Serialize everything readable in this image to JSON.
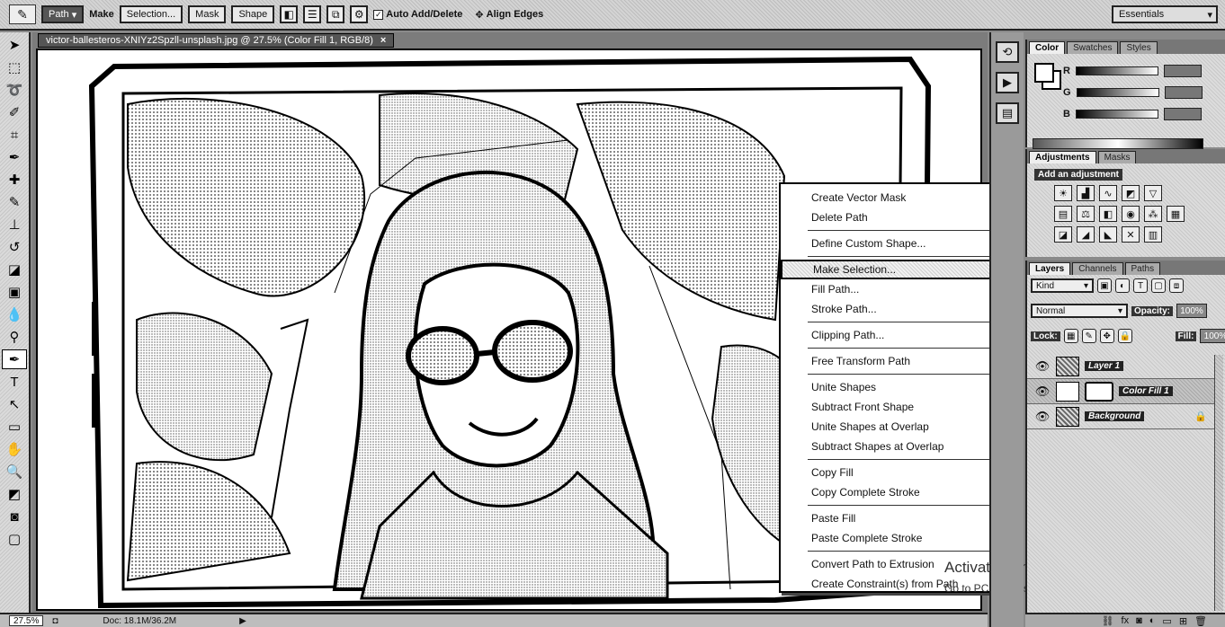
{
  "options_bar": {
    "mode_buttons": [
      "Path",
      "Make",
      "Selection...",
      "Mask",
      "Shape"
    ],
    "mode_label": "Make:",
    "auto_add_delete": "Auto Add/Delete",
    "align_edges": "Align Edges",
    "workspace": "Essentials"
  },
  "document": {
    "tab_title": "victor-ballesteros-XNIYz2Spzll-unsplash.jpg @ 27.5% (Color Fill 1, RGB/8)",
    "tab_close": "×",
    "zoom": "27.5%",
    "doc_size": "Doc: 18.1M/36.2M"
  },
  "context_menu": {
    "items": [
      "Create Vector Mask",
      "Delete Path",
      "Define Custom Shape...",
      "Make Selection...",
      "Fill Path...",
      "Stroke Path...",
      "Clipping Path...",
      "Free Transform Path",
      "Unite Shapes",
      "Subtract Front Shape",
      "Unite Shapes at Overlap",
      "Subtract Shapes at Overlap",
      "Copy Fill",
      "Copy Complete Stroke",
      "Paste Fill",
      "Paste Complete Stroke",
      "Convert Path to Extrusion",
      "Create Constraint(s) from Path"
    ],
    "highlighted": "Make Selection..."
  },
  "color_panel": {
    "tabs": [
      "Color",
      "Swatches",
      "Styles"
    ],
    "channels": [
      "R",
      "G",
      "B"
    ]
  },
  "adjustments_panel": {
    "tabs": [
      "Adjustments",
      "Masks"
    ],
    "title": "Add an adjustment"
  },
  "layers_panel": {
    "tabs": [
      "Layers",
      "Channels",
      "Paths"
    ],
    "kind": "Kind",
    "blend_mode": "Normal",
    "opacity_label": "Opacity:",
    "opacity": "100%",
    "lock_label": "Lock:",
    "fill_label": "Fill:",
    "fill": "100%",
    "layers": [
      {
        "name": "Layer 1",
        "selected": false
      },
      {
        "name": "Color Fill 1",
        "selected": true
      },
      {
        "name": "Background",
        "selected": false
      }
    ]
  },
  "watermark": {
    "line1": "Activate Windows",
    "line2": "Go to PC settings to activate Windows."
  },
  "colors": {
    "highlight": "#f1f1f1",
    "panel": "#d4d4d4",
    "dark": "#222222"
  }
}
